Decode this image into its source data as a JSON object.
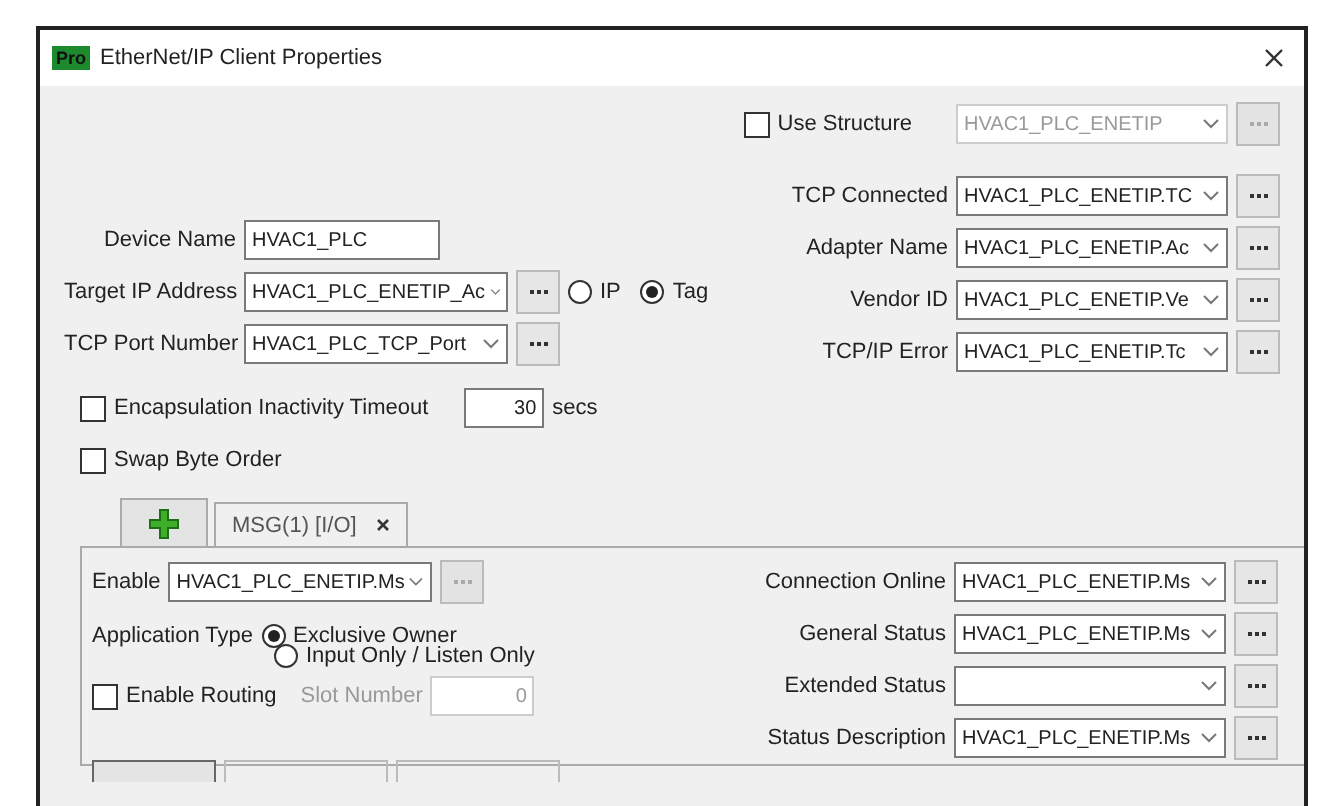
{
  "window": {
    "badge": "Pro",
    "title": "EtherNet/IP Client Properties"
  },
  "use_structure": {
    "label": "Use Structure",
    "checked": false,
    "value": "HVAC1_PLC_ENETIP",
    "disabled": true
  },
  "device": {
    "name": {
      "label": "Device Name",
      "value": "HVAC1_PLC"
    },
    "target": {
      "label": "Target IP Address",
      "value": "HVAC1_PLC_ENETIP_Ac",
      "modes": [
        {
          "label": "IP",
          "selected": false
        },
        {
          "label": "Tag",
          "selected": true
        }
      ]
    },
    "port": {
      "label": "TCP Port Number",
      "value": "HVAC1_PLC_TCP_Port"
    }
  },
  "connection_fields": [
    {
      "label": "TCP Connected",
      "value": "HVAC1_PLC_ENETIP.TC"
    },
    {
      "label": "Adapter Name",
      "value": "HVAC1_PLC_ENETIP.Ac"
    },
    {
      "label": "Vendor ID",
      "value": "HVAC1_PLC_ENETIP.Ve"
    },
    {
      "label": "TCP/IP Error",
      "value": "HVAC1_PLC_ENETIP.Tc"
    }
  ],
  "options": [
    {
      "kind": "timeout",
      "label": "Encapsulation Inactivity Timeout",
      "checked": false,
      "value": "30",
      "unit": "secs"
    },
    {
      "kind": "plain",
      "label": "Swap Byte Order",
      "checked": false
    }
  ],
  "message_tabs": [
    {
      "label": "MSG(1) [I/O]",
      "selected": true
    }
  ],
  "message": {
    "enable": {
      "label": "Enable",
      "value": "HVAC1_PLC_ENETIP.Ms"
    },
    "application_type": {
      "label": "Application Type",
      "options": [
        {
          "label": "Exclusive Owner",
          "selected": true
        },
        {
          "label": "Input Only / Listen Only",
          "selected": false
        }
      ]
    },
    "routing": {
      "label": "Enable Routing",
      "checked": false,
      "slot_label": "Slot Number",
      "slot_value": "0"
    },
    "status_fields": [
      {
        "label": "Connection Online",
        "value": "HVAC1_PLC_ENETIP.Ms"
      },
      {
        "label": "General Status",
        "value": "HVAC1_PLC_ENETIP.Ms"
      },
      {
        "label": "Extended Status"
      },
      {
        "label": "Status Description",
        "value": "HVAC1_PLC_ENETIP.Ms"
      }
    ],
    "data_tabs": [
      {
        "selected": true
      },
      {
        "selected": false
      },
      {
        "selected": false
      }
    ]
  }
}
